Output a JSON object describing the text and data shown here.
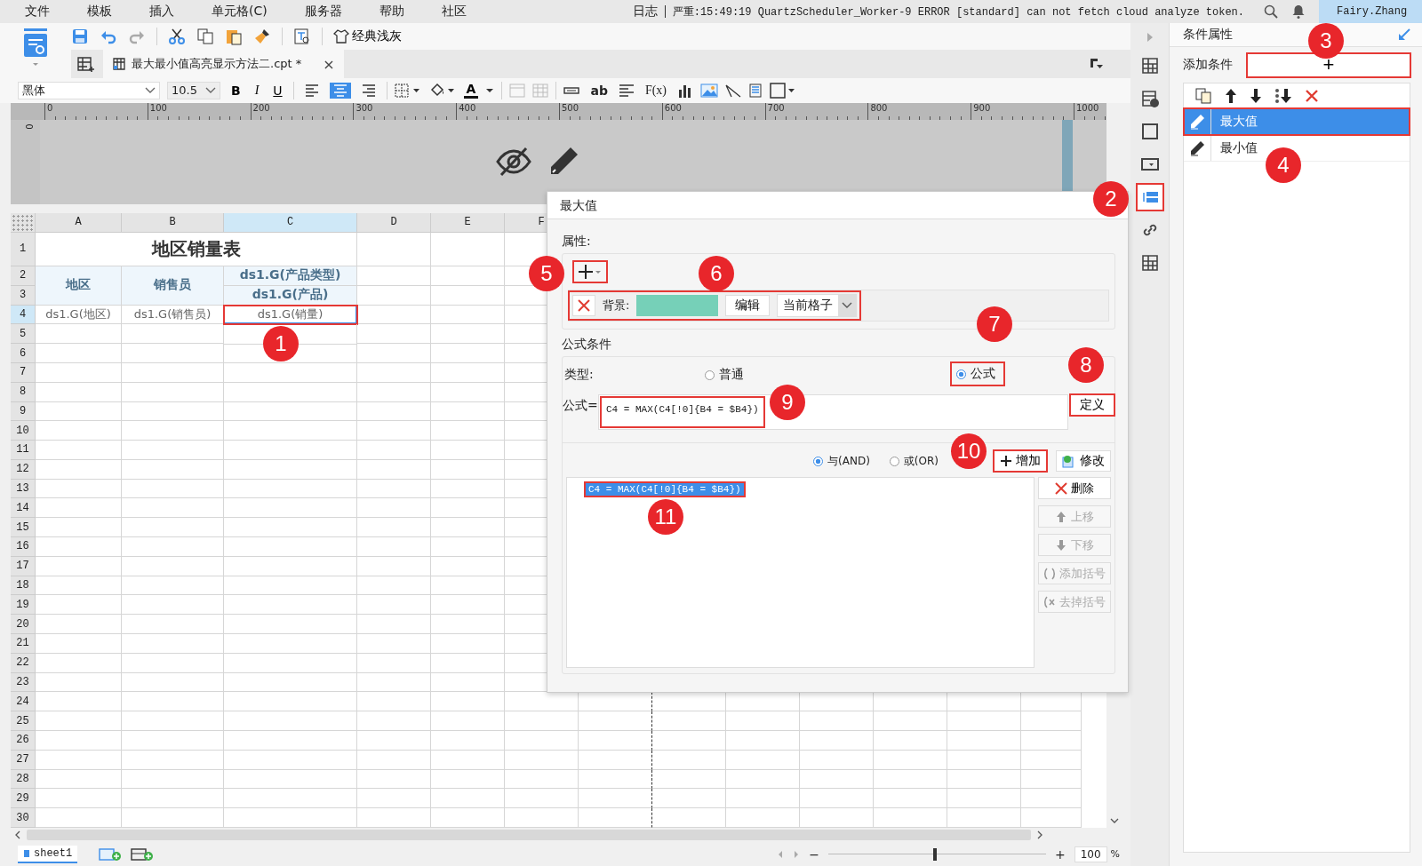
{
  "menu": [
    "文件",
    "模板",
    "插入",
    "单元格(C)",
    "服务器",
    "帮助",
    "社区"
  ],
  "log": {
    "label": "日志",
    "message": "严重:15:49:19 QuartzScheduler_Worker-9 ERROR [standard] can not fetch cloud analyze token."
  },
  "user": "Fairy.Zhang",
  "toolbar": {
    "theme": "经典浅灰"
  },
  "tabs": [
    {
      "title": "最大最小值高亮显示方法二.cpt *",
      "close": "×",
      "selected": true
    }
  ],
  "format_bar": {
    "font": "黑体",
    "size": "10.5",
    "bold": "B",
    "italic": "I",
    "underline": "U",
    "align": [
      {
        "selected": false
      },
      {
        "selected": true
      },
      {
        "selected": false
      }
    ],
    "font_color": "A",
    "wrap": "ab",
    "formula": "F(x)"
  },
  "ruler": {
    "ticks": [
      "0",
      "100",
      "200",
      "300",
      "400",
      "500",
      "600",
      "700",
      "800",
      "900",
      "1000"
    ],
    "vertical": "0"
  },
  "sheet": {
    "columns": [
      {
        "label": "A",
        "selected": false
      },
      {
        "label": "B",
        "selected": false
      },
      {
        "label": "C",
        "selected": true
      },
      {
        "label": "D",
        "selected": false
      },
      {
        "label": "E",
        "selected": false
      },
      {
        "label": "F",
        "selected": false
      }
    ],
    "rows": [
      {
        "label": "1",
        "selected": false
      },
      {
        "label": "2",
        "selected": false
      },
      {
        "label": "3",
        "selected": false
      },
      {
        "label": "4",
        "selected": true
      },
      {
        "label": "5",
        "selected": false
      },
      {
        "label": "6",
        "selected": false
      },
      {
        "label": "7",
        "selected": false
      },
      {
        "label": "8",
        "selected": false
      },
      {
        "label": "9",
        "selected": false
      },
      {
        "label": "10",
        "selected": false
      },
      {
        "label": "11",
        "selected": false
      },
      {
        "label": "12",
        "selected": false
      },
      {
        "label": "13",
        "selected": false
      },
      {
        "label": "14",
        "selected": false
      },
      {
        "label": "15",
        "selected": false
      },
      {
        "label": "16",
        "selected": false
      },
      {
        "label": "17",
        "selected": false
      },
      {
        "label": "18",
        "selected": false
      },
      {
        "label": "19",
        "selected": false
      },
      {
        "label": "20",
        "selected": false
      },
      {
        "label": "21",
        "selected": false
      },
      {
        "label": "22",
        "selected": false
      },
      {
        "label": "23",
        "selected": false
      },
      {
        "label": "24",
        "selected": false
      },
      {
        "label": "25",
        "selected": false
      },
      {
        "label": "26",
        "selected": false
      },
      {
        "label": "27",
        "selected": false
      },
      {
        "label": "28",
        "selected": false
      },
      {
        "label": "29",
        "selected": false
      },
      {
        "label": "30",
        "selected": false
      }
    ],
    "cells": [
      {
        "kind": "title",
        "text": "地区销量表",
        "selected": false,
        "marked": false
      },
      {
        "kind": "header",
        "text": "地区",
        "selected": false,
        "marked": false
      },
      {
        "kind": "header",
        "text": "销售员",
        "selected": false,
        "marked": false
      },
      {
        "kind": "header",
        "text": "ds1.G(产品类型)",
        "selected": false,
        "marked": false
      },
      {
        "kind": "header",
        "text": "ds1.G(产品)",
        "selected": false,
        "marked": false
      },
      {
        "kind": "field",
        "text": "ds1.G(地区)",
        "selected": false,
        "marked": false
      },
      {
        "kind": "field",
        "text": "ds1.G(销售员)",
        "selected": false,
        "marked": false
      },
      {
        "kind": "field",
        "text": "ds1.G(销量)",
        "selected": true,
        "marked": true
      }
    ]
  },
  "sheet_tabs": [
    {
      "label": "sheet1",
      "selected": true
    }
  ],
  "zoom": {
    "minus": "−",
    "level": 0.49,
    "plus": "+",
    "value": "100",
    "unit": "%"
  },
  "side_strip": [
    {
      "selected": false,
      "marked": false
    },
    {
      "selected": false,
      "marked": false
    },
    {
      "selected": false,
      "marked": false
    },
    {
      "selected": false,
      "marked": false
    },
    {
      "selected": true,
      "marked": true
    },
    {
      "selected": false,
      "marked": false
    },
    {
      "selected": false,
      "marked": false
    }
  ],
  "panel": {
    "title": "条件属性",
    "add_label": "添加条件",
    "add_button": "+",
    "add_marked": true,
    "conditions": [
      {
        "name": "最大值",
        "selected": true,
        "marked": true
      },
      {
        "name": "最小值",
        "selected": false,
        "marked": false
      }
    ]
  },
  "dialog": {
    "title": "最大值",
    "attributes": {
      "label": "属性:",
      "add_marked": true,
      "rows": [
        {
          "kind": "background",
          "label": "背景:",
          "color": "#76d0b8",
          "edit": "编辑",
          "scope": "当前格子",
          "marked": true
        }
      ]
    },
    "condition": {
      "label": "公式条件",
      "type_label": "类型:",
      "types": [
        {
          "label": "普通",
          "selected": false,
          "marked": false
        },
        {
          "label": "公式",
          "selected": true,
          "marked": true
        }
      ],
      "formula_label": "公式=",
      "formula": "C4 = MAX(C4[!0]{B4 = $B4})",
      "formula_marked": true,
      "define": "定义",
      "define_marked": true,
      "logic": [
        {
          "label": "与(AND)",
          "selected": true
        },
        {
          "label": "或(OR)",
          "selected": false
        }
      ],
      "add": "增加",
      "add_marked": true,
      "modify": "修改",
      "items": [
        {
          "text": "C4 = MAX(C4[!0]{B4 = $B4})",
          "selected": true,
          "marked": true
        }
      ],
      "actions": [
        {
          "label": "删除",
          "disabled": false
        },
        {
          "label": "上移",
          "disabled": true
        },
        {
          "label": "下移",
          "disabled": true
        },
        {
          "label": "添加括号",
          "disabled": true
        },
        {
          "label": "去掉括号",
          "disabled": true
        }
      ]
    }
  },
  "annotations": [
    "1",
    "2",
    "3",
    "4",
    "5",
    "6",
    "7",
    "8",
    "9",
    "10",
    "11"
  ]
}
